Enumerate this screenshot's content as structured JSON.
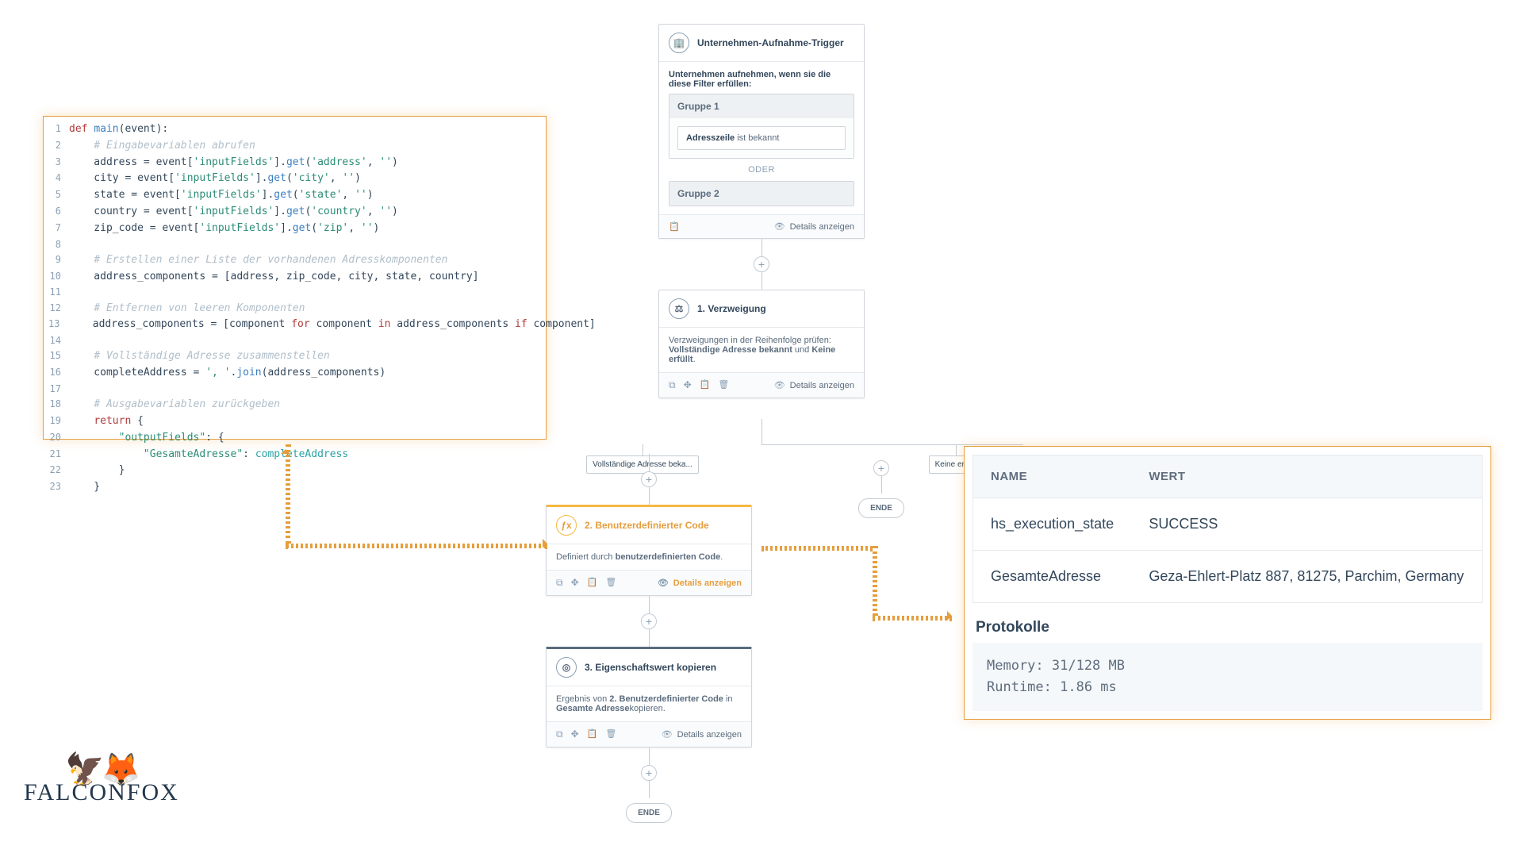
{
  "code": {
    "lines": [
      {
        "n": 1,
        "html": "<span class='kw'>def</span> <span class='fn'>main</span>(event):"
      },
      {
        "n": 2,
        "html": "    <span class='com'># Eingabevariablen abrufen</span>"
      },
      {
        "n": 3,
        "html": "    address = event[<span class='str'>'inputFields'</span>].<span class='fn'>get</span>(<span class='str'>'address'</span>, <span class='str'>''</span>)"
      },
      {
        "n": 4,
        "html": "    city = event[<span class='str'>'inputFields'</span>].<span class='fn'>get</span>(<span class='str'>'city'</span>, <span class='str'>''</span>)"
      },
      {
        "n": 5,
        "html": "    state = event[<span class='str'>'inputFields'</span>].<span class='fn'>get</span>(<span class='str'>'state'</span>, <span class='str'>''</span>)"
      },
      {
        "n": 6,
        "html": "    country = event[<span class='str'>'inputFields'</span>].<span class='fn'>get</span>(<span class='str'>'country'</span>, <span class='str'>''</span>)"
      },
      {
        "n": 7,
        "html": "    zip_code = event[<span class='str'>'inputFields'</span>].<span class='fn'>get</span>(<span class='str'>'zip'</span>, <span class='str'>''</span>)"
      },
      {
        "n": 8,
        "html": ""
      },
      {
        "n": 9,
        "html": "    <span class='com'># Erstellen einer Liste der vorhandenen Adresskomponenten</span>"
      },
      {
        "n": 10,
        "html": "    address_components = [address, zip_code, city, state, country]"
      },
      {
        "n": 11,
        "html": ""
      },
      {
        "n": 12,
        "html": "    <span class='com'># Entfernen von leeren Komponenten</span>"
      },
      {
        "n": 13,
        "html": "    address_components = [component <span class='kw'>for</span> component <span class='kw'>in</span> address_components <span class='kw'>if</span> component]"
      },
      {
        "n": 14,
        "html": ""
      },
      {
        "n": 15,
        "html": "    <span class='com'># Vollständige Adresse zusammenstellen</span>"
      },
      {
        "n": 16,
        "html": "    completeAddress = <span class='str'>', '</span>.<span class='fn'>join</span>(address_components)"
      },
      {
        "n": 17,
        "html": ""
      },
      {
        "n": 18,
        "html": "    <span class='com'># Ausgabevariablen zurückgeben</span>"
      },
      {
        "n": 19,
        "html": "    <span class='kw'>return</span> {"
      },
      {
        "n": 20,
        "html": "        <span class='str'>\"outputFields\"</span>: {"
      },
      {
        "n": 21,
        "html": "            <span class='str'>\"GesamteAdresse\"</span>: <span class='id'>completeAddress</span>"
      },
      {
        "n": 22,
        "html": "        }"
      },
      {
        "n": 23,
        "html": "    }"
      }
    ]
  },
  "trigger": {
    "title": "Unternehmen-Aufnahme-Trigger",
    "subtitle": "Unternehmen aufnehmen, wenn sie die diese Filter erfüllen:",
    "group1_label": "Gruppe 1",
    "group1_chip_bold": "Adresszeile",
    "group1_chip_rest": " ist bekannt",
    "or_label": "ODER",
    "group2_label": "Gruppe 2",
    "details": "Details anzeigen"
  },
  "branch_card": {
    "title": "1. Verzweigung",
    "desc_prefix": "Verzweigungen in der Reihenfolge prüfen: ",
    "bold1": "Vollständige Adresse bekannt",
    "mid": " und ",
    "bold2": "Keine erfüllt",
    "details": "Details anzeigen"
  },
  "branches": {
    "left_label": "Vollständige Adresse beka...",
    "right_label": "Keine erfüllt",
    "ende": "ENDE"
  },
  "custom_code": {
    "title": "2. Benutzerdefinierter Code",
    "desc_prefix": "Definiert durch ",
    "bold": "benutzerdefinierten Code",
    "details": "Details anzeigen"
  },
  "copy_prop": {
    "title": "3. Eigenschaftswert kopieren",
    "desc_prefix": "Ergebnis von ",
    "bold1": "2. Benutzerdefinierter Code",
    "mid": " in ",
    "bold2": "Gesamte Adresse",
    "suffix": "kopieren.",
    "details": "Details anzeigen"
  },
  "results": {
    "header_name": "NAME",
    "header_value": "WERT",
    "rows": [
      {
        "name": "hs_execution_state",
        "value": "SUCCESS"
      },
      {
        "name": "GesamteAdresse",
        "value": "Geza-Ehlert-Platz 887, 81275, Parchim, Germany"
      }
    ],
    "protokolle": "Protokolle",
    "log_memory": "Memory: 31/128 MB",
    "log_runtime": "Runtime: 1.86 ms"
  },
  "logo_name": "FALCONFOX"
}
